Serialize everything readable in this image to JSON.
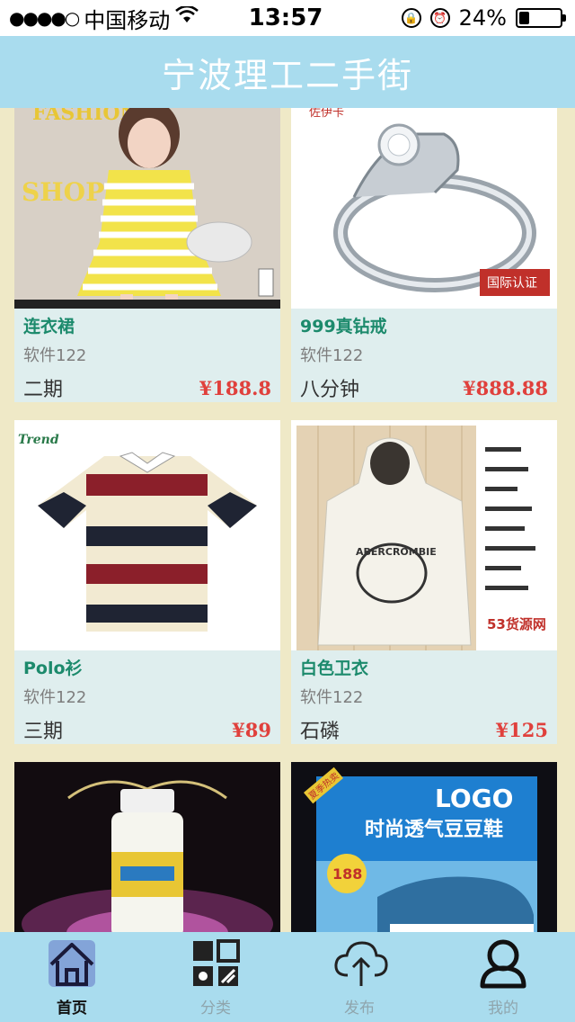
{
  "status_bar": {
    "signal": "●●●●○",
    "carrier": "中国移动",
    "time": "13:57",
    "battery": "24%",
    "battery_level": 0.24
  },
  "header": {
    "title": "宁波理工二手街"
  },
  "products": [
    {
      "name": "连衣裙",
      "class": "软件122",
      "seller": "二期",
      "price": "¥188.8"
    },
    {
      "name": "999真钻戒",
      "class": "软件122",
      "seller": "八分钟",
      "price": "¥888.88"
    },
    {
      "name": "Polo衫",
      "class": "软件122",
      "seller": "三期",
      "price": "¥89"
    },
    {
      "name": "白色卫衣",
      "class": "软件122",
      "seller": "石磷",
      "price": "¥125"
    }
  ],
  "image_text": {
    "dress_top": "FASHION",
    "dress_shop": "SHOP",
    "ring_badge": "国际认证",
    "ring_top": "佐伊卡",
    "polo_brand": "Trend",
    "hoodie_brand": "53货源网",
    "shoe_logo": "LOGO",
    "shoe_tag": "夏季热卖",
    "shoe_title": "时尚透气豆豆鞋",
    "shoe_price": "188"
  },
  "tabs": [
    {
      "label": "首页",
      "icon": "home-icon",
      "active": true
    },
    {
      "label": "分类",
      "icon": "category-icon",
      "active": false
    },
    {
      "label": "发布",
      "icon": "upload-cloud-icon",
      "active": false
    },
    {
      "label": "我的",
      "icon": "user-icon",
      "active": false
    }
  ],
  "colors": {
    "header_bg": "#a9dcee",
    "page_bg": "#efe9c7",
    "card_bg": "#dfeeee",
    "name_color": "#1c8a6c",
    "price_color": "#e0403c"
  }
}
